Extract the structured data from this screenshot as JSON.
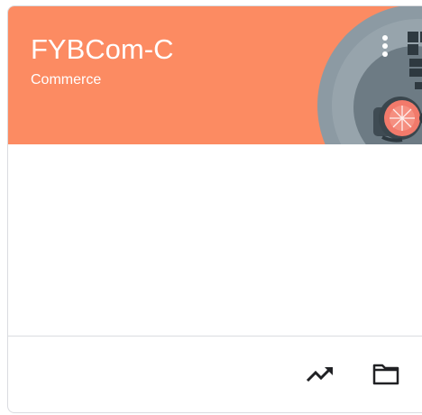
{
  "card": {
    "title": "FYBCom-C",
    "subtitle": "Commerce",
    "header_color": "#fc8b62",
    "icons": {
      "more": "more-vert-icon",
      "trend": "trending-up-icon",
      "folder": "folder-icon"
    }
  }
}
